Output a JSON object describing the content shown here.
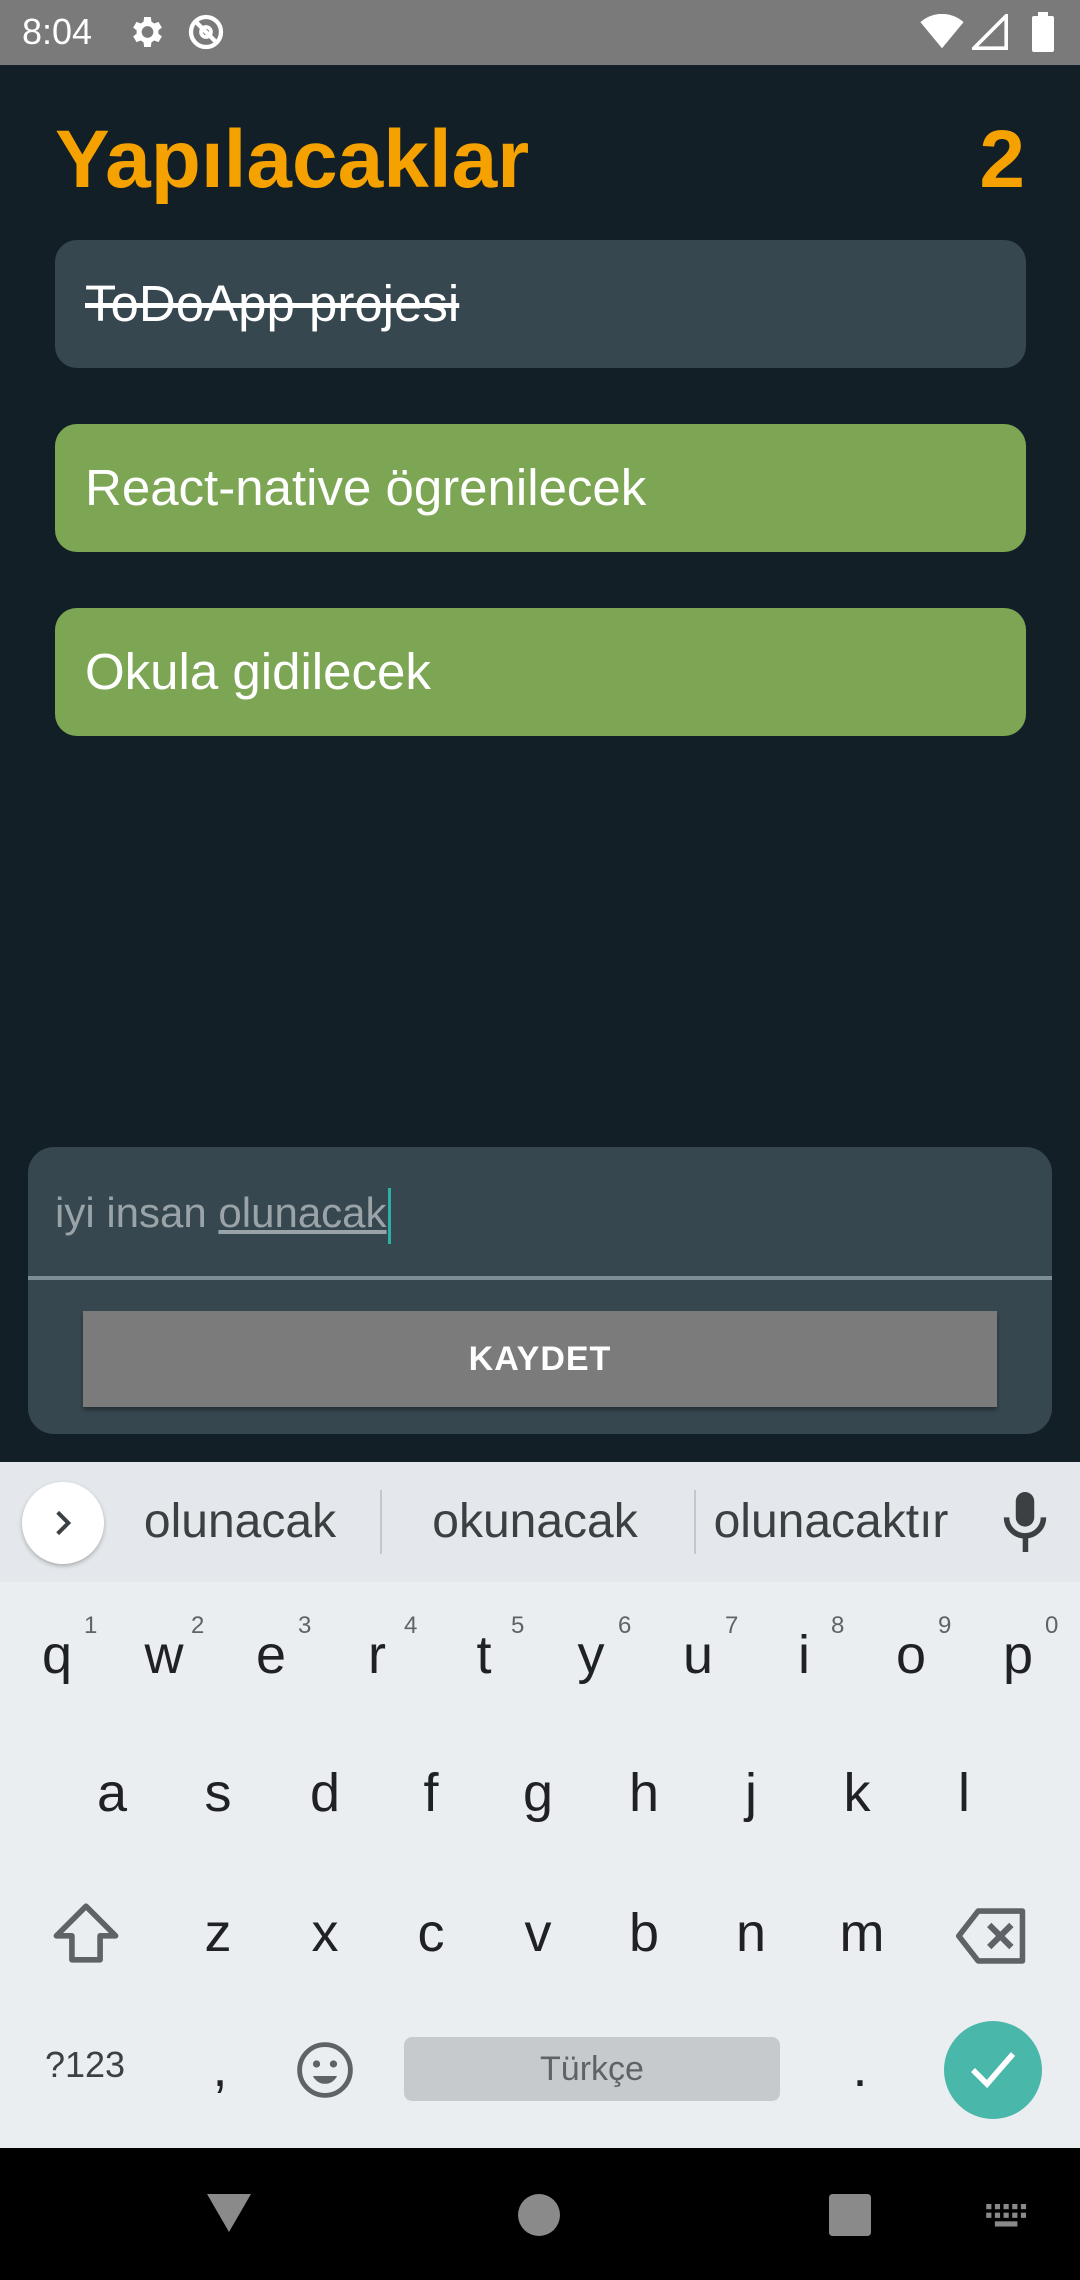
{
  "status_bar": {
    "time": "8:04",
    "left_icons": [
      "settings-icon",
      "do-not-disturb-icon"
    ],
    "right_icons": [
      "wifi-icon",
      "signal-icon",
      "battery-icon"
    ]
  },
  "header": {
    "title": "Yapılacaklar",
    "pending_count": "2"
  },
  "todos": [
    {
      "text": "ToDoApp projesi",
      "done": true
    },
    {
      "text": "React-native ögrenilecek",
      "done": false
    },
    {
      "text": "Okula gidilecek",
      "done": false
    }
  ],
  "colors": {
    "background": "#131f26",
    "accent": "#f5a100",
    "done_item": "#37474f",
    "open_item": "#7ca654",
    "button": "#7b7b7b",
    "keyboard_enter": "#49b7a9"
  },
  "new_todo": {
    "value_plain": "iyi insan ",
    "value_composing": "olunacak",
    "save_label": "KAYDET"
  },
  "keyboard": {
    "suggestions": [
      "olunacak",
      "okunacak",
      "olunacaktır"
    ],
    "row1": [
      {
        "key": "q",
        "hint": "1"
      },
      {
        "key": "w",
        "hint": "2"
      },
      {
        "key": "e",
        "hint": "3"
      },
      {
        "key": "r",
        "hint": "4"
      },
      {
        "key": "t",
        "hint": "5"
      },
      {
        "key": "y",
        "hint": "6"
      },
      {
        "key": "u",
        "hint": "7"
      },
      {
        "key": "i",
        "hint": "8"
      },
      {
        "key": "o",
        "hint": "9"
      },
      {
        "key": "p",
        "hint": "0"
      }
    ],
    "row2": [
      "a",
      "s",
      "d",
      "f",
      "g",
      "h",
      "j",
      "k",
      "l"
    ],
    "row3": [
      "z",
      "x",
      "c",
      "v",
      "b",
      "n",
      "m"
    ],
    "symbols_label": "?123",
    "comma_label": ",",
    "space_label": "Türkçe",
    "period_label": "."
  },
  "nav_bar": {
    "buttons": [
      "back-icon",
      "home-icon",
      "recents-icon",
      "keyboard-switch-icon"
    ]
  }
}
